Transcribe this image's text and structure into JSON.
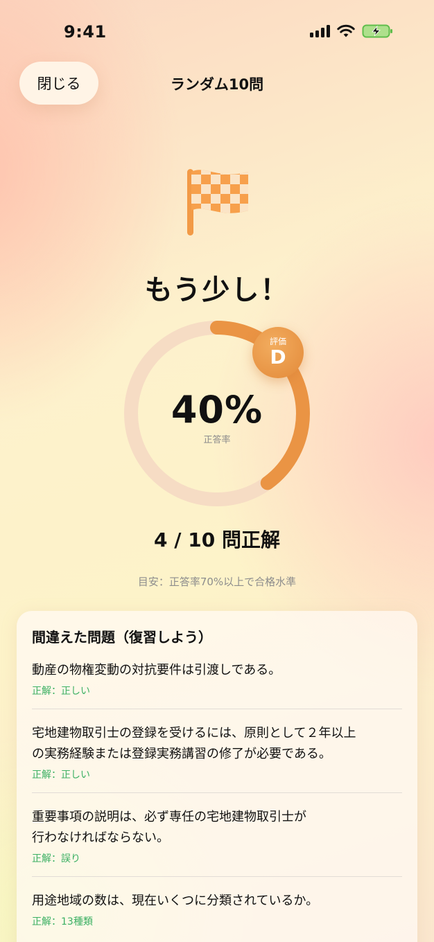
{
  "status_bar": {
    "time": "9:41"
  },
  "header": {
    "close_label": "閉じる",
    "title": "ランダム10問"
  },
  "result": {
    "headline": "もう少し！",
    "percent_text": "40%",
    "percent_label": "正答率",
    "accuracy": 0.4,
    "badge_label": "評価",
    "grade": "D",
    "score_text": "4 / 10 問正解",
    "hint": "目安：正答率70%以上で合格水準"
  },
  "review": {
    "title": "間違えた問題（復習しよう）",
    "items": [
      {
        "question": "動産の物権変動の対抗要件は引渡しである。",
        "answer": "正解：正しい"
      },
      {
        "question": "宅地建物取引士の登録を受けるには、原則として２年以上\nの実務経験または登録実務講習の修了が必要である。",
        "answer": "正解：正しい"
      },
      {
        "question": "重要事項の説明は、必ず専任の宅地建物取引士が\n行わなければならない。",
        "answer": "正解：誤り"
      },
      {
        "question": "用途地域の数は、現在いくつに分類されているか。",
        "answer": "正解：13種類"
      }
    ]
  },
  "colors": {
    "accent": "#ea9444",
    "ring_track": "#f6dcc4",
    "correct": "#3bb063"
  },
  "icons": {
    "flag": "checkered-flag-icon"
  }
}
